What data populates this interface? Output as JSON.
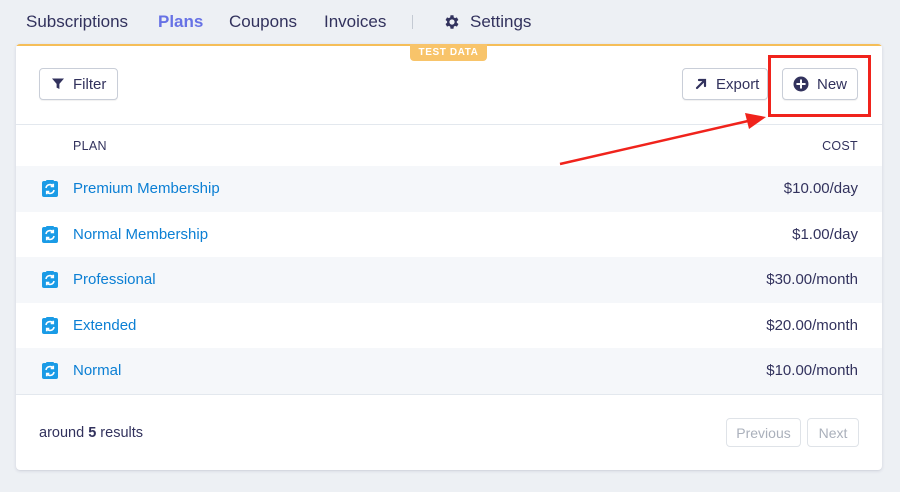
{
  "nav": {
    "tabs": [
      {
        "label": "Subscriptions"
      },
      {
        "label": "Plans"
      },
      {
        "label": "Coupons"
      },
      {
        "label": "Invoices"
      }
    ],
    "settings_label": "Settings"
  },
  "badge": "TEST DATA",
  "toolbar": {
    "filter_label": "Filter",
    "export_label": "Export",
    "new_label": "New"
  },
  "table": {
    "headers": {
      "plan": "PLAN",
      "cost": "COST"
    },
    "rows": [
      {
        "name": "Premium Membership",
        "cost": "$10.00/day"
      },
      {
        "name": "Normal Membership",
        "cost": "$1.00/day"
      },
      {
        "name": "Professional",
        "cost": "$30.00/month"
      },
      {
        "name": "Extended",
        "cost": "$20.00/month"
      },
      {
        "name": "Normal",
        "cost": "$10.00/month"
      }
    ]
  },
  "footer": {
    "prefix": "around",
    "count": "5",
    "suffix": "results",
    "previous_label": "Previous",
    "next_label": "Next"
  },
  "colors": {
    "accent": "#6772e5",
    "link": "#0b7fd4",
    "badge": "#f8c46a",
    "annotation": "#f0231c"
  },
  "icons": {
    "filter": "filter-icon",
    "export": "arrow-up-right-icon",
    "new": "plus-circle-icon",
    "settings": "gear-icon",
    "plan": "plan-icon"
  }
}
